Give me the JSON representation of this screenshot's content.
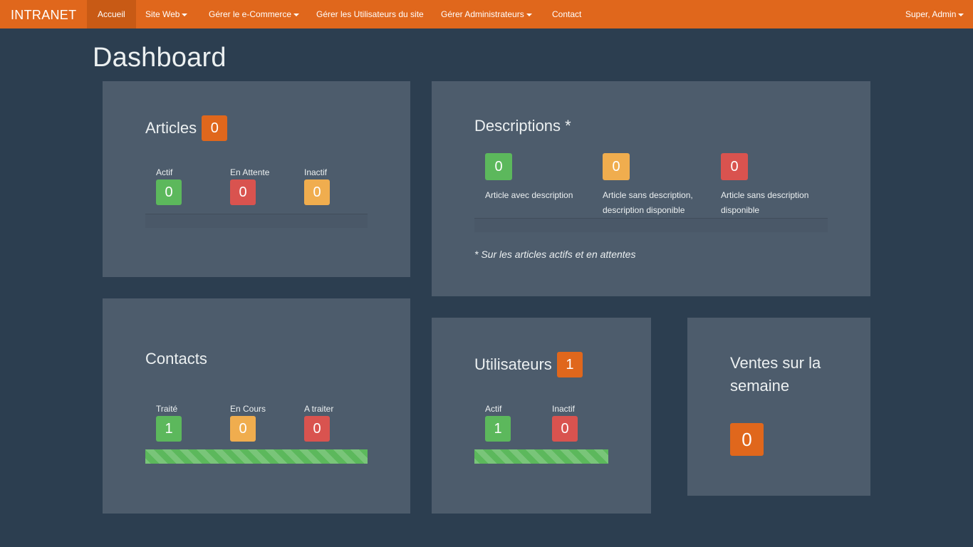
{
  "navbar": {
    "brand": "INTRANET",
    "items": [
      {
        "label": "Accueil"
      },
      {
        "label": "Site Web"
      },
      {
        "label": "Gérer le e-Commerce"
      },
      {
        "label": "Gérer les Utilisateurs du site"
      },
      {
        "label": "Gérer Administrateurs"
      },
      {
        "label": "Contact"
      }
    ],
    "user": "Super, Admin"
  },
  "page": {
    "title": "Dashboard"
  },
  "articles": {
    "title": "Articles",
    "count": "0",
    "stats": [
      {
        "label": "Actif",
        "value": "0"
      },
      {
        "label": "En Attente",
        "value": "0"
      },
      {
        "label": "Inactif",
        "value": "0"
      }
    ]
  },
  "descriptions": {
    "title": "Descriptions *",
    "stats": [
      {
        "label": "Article avec description",
        "value": "0"
      },
      {
        "label": "Article sans description, description disponible",
        "value": "0"
      },
      {
        "label": "Article sans description disponible",
        "value": "0"
      }
    ],
    "footnote": "* Sur les articles actifs et en attentes"
  },
  "contacts": {
    "title": "Contacts",
    "stats": [
      {
        "label": "Traité",
        "value": "1"
      },
      {
        "label": "En Cours",
        "value": "0"
      },
      {
        "label": "A traiter",
        "value": "0"
      }
    ],
    "progress_treated_fraction": 1.0
  },
  "utilisateurs": {
    "title": "Utilisateurs",
    "count": "1",
    "stats": [
      {
        "label": "Actif",
        "value": "1"
      },
      {
        "label": "Inactif",
        "value": "0"
      }
    ],
    "progress_active_fraction": 1.0
  },
  "ventes": {
    "title": "Ventes sur la semaine",
    "value": "0"
  },
  "colors": {
    "navbar": "#e0671c",
    "background": "#2c3e50",
    "panel": "#4d5c6c",
    "success": "#5cb85c",
    "danger": "#d9534f",
    "warning": "#f0ad4e"
  }
}
